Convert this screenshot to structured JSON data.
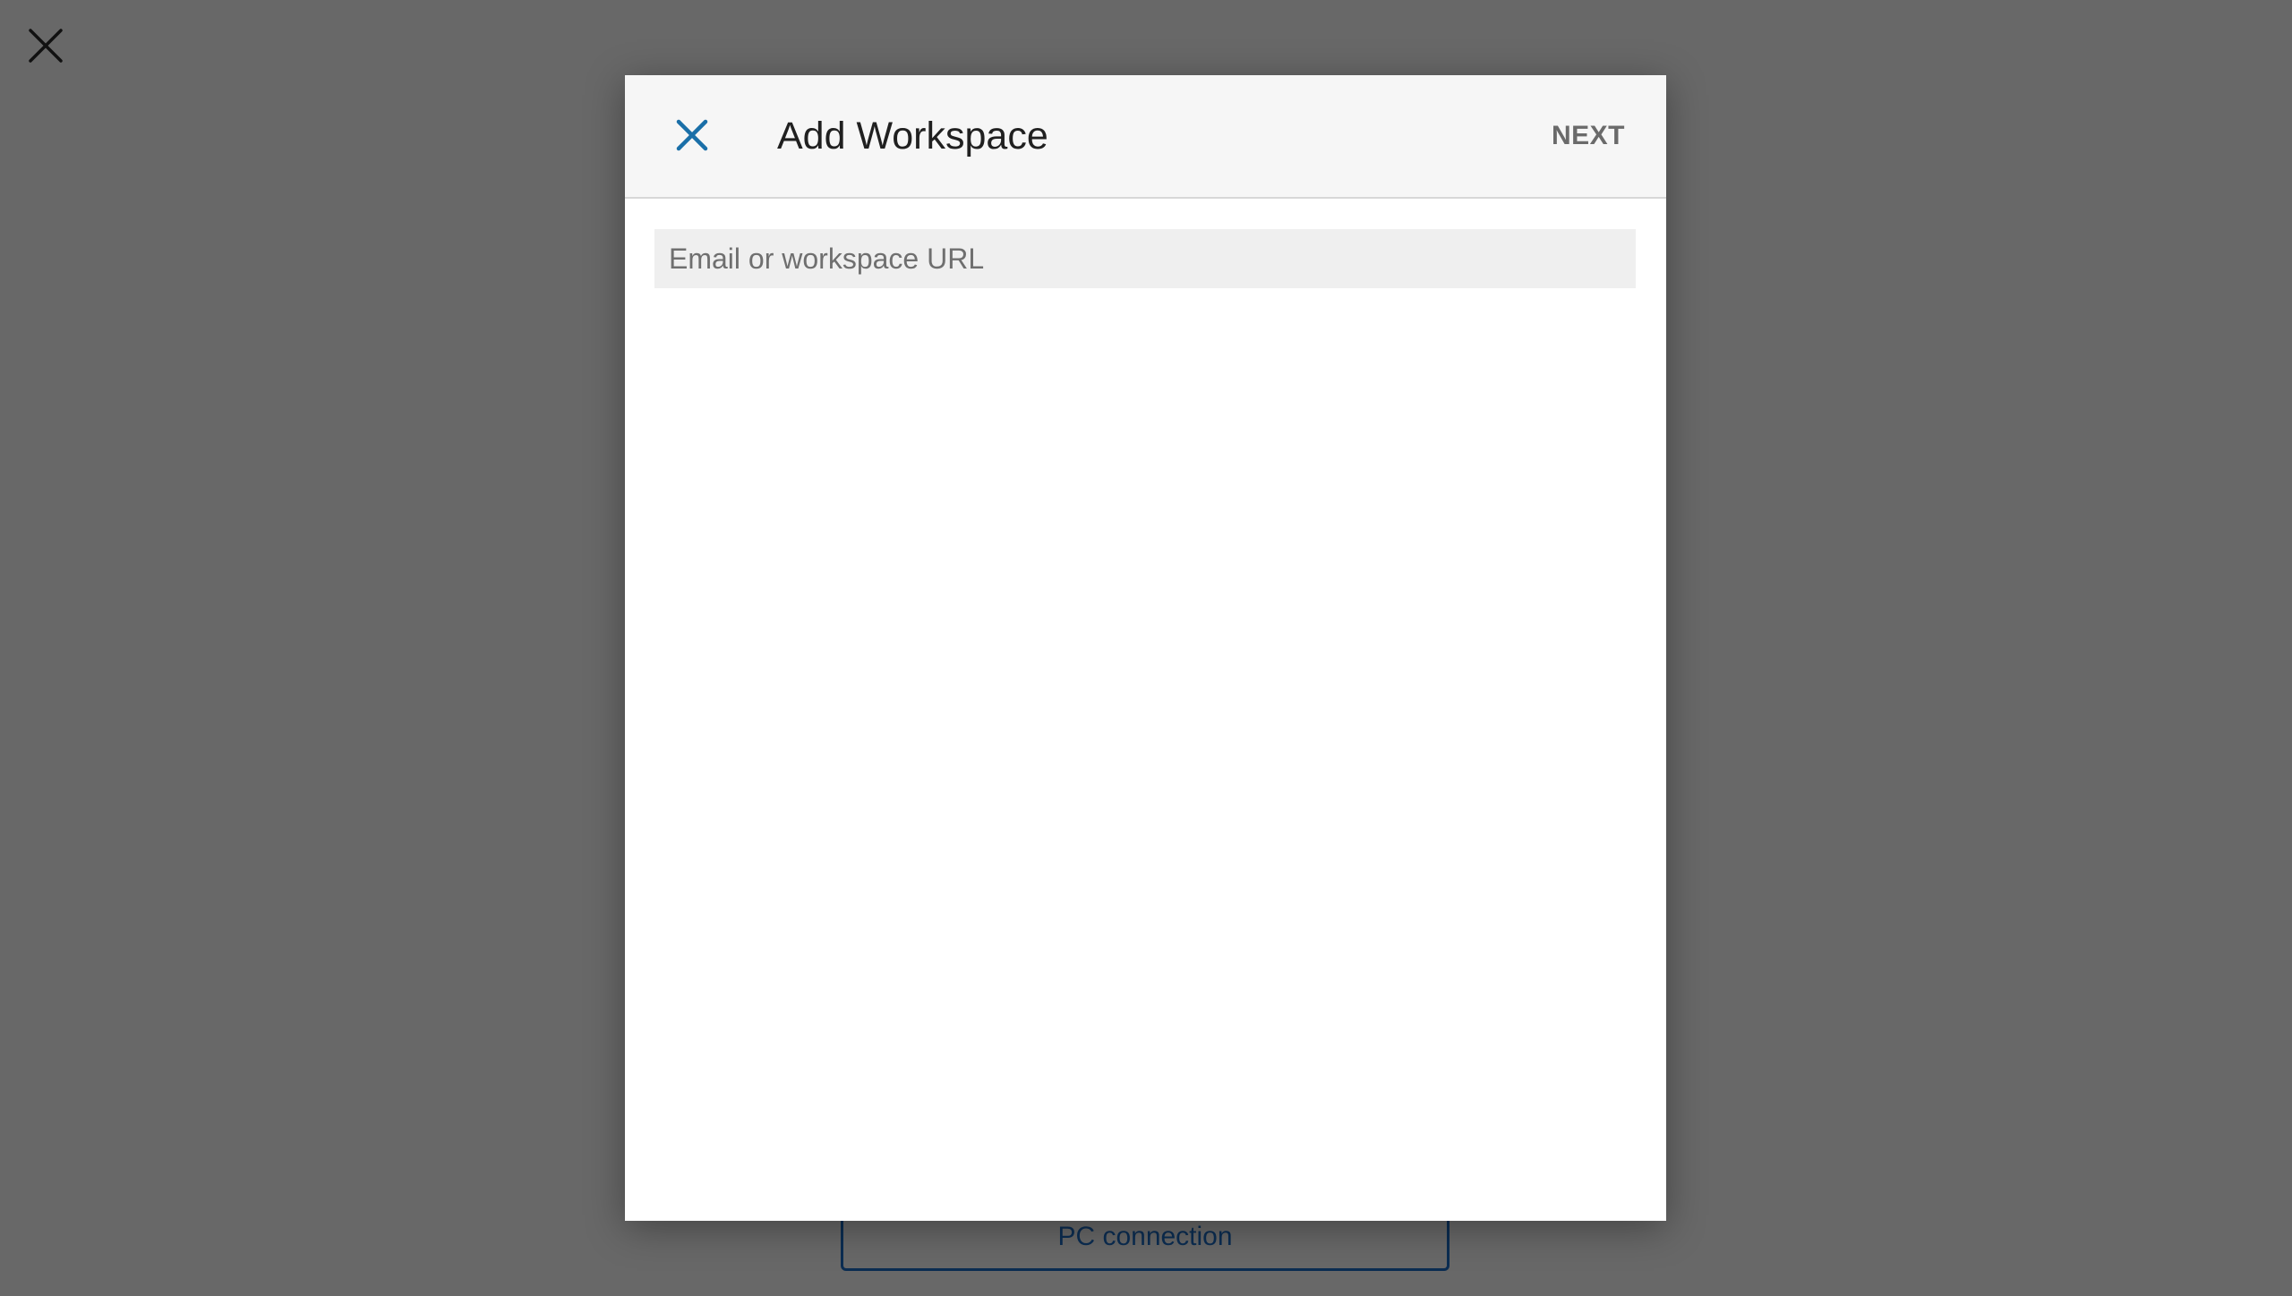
{
  "background": {
    "close_icon": "close-icon",
    "pc_connection_label": "PC connection"
  },
  "dialog": {
    "title": "Add Workspace",
    "close_icon": "close-icon",
    "next_label": "NEXT",
    "input": {
      "value": "",
      "placeholder": "Email or workspace URL"
    }
  },
  "colors": {
    "overlay": "#686868",
    "accent": "#1a6fa8",
    "header_bg": "#f6f6f6",
    "input_bg": "#efefef",
    "pc_button": "#0b2d52"
  }
}
